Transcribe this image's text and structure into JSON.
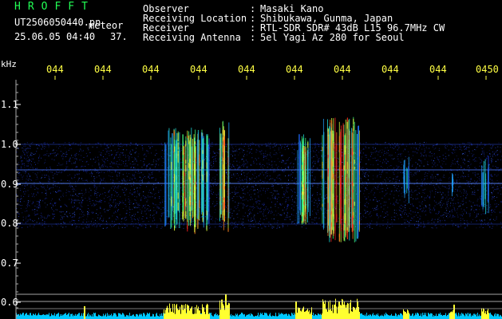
{
  "header": {
    "brand": "HROFFT",
    "filename": "UT2506050440.pn",
    "mode": "meteor",
    "datetime": "25.06.05 04:40",
    "count": "37.",
    "fields": [
      {
        "label": "Observer",
        "value": "Masaki Kano"
      },
      {
        "label": "Receiving Location",
        "value": "Shibukawa, Gunma, Japan"
      },
      {
        "label": "Receiver",
        "value": "RTL-SDR SDR# 43dB L15 96.7MHz CW"
      },
      {
        "label": "Receiving Antenna",
        "value": "5el Yagi Az 280 for Seoul"
      }
    ],
    "separator": ":"
  },
  "axes": {
    "y_unit": "kHz",
    "y_ticks": [
      "1.1",
      "1.0",
      "0.9",
      "0.8",
      "0.7",
      "0.6"
    ],
    "x_ticks": [
      "044",
      "044",
      "044",
      "044",
      "044",
      "044",
      "044",
      "044",
      "044",
      "0450"
    ]
  },
  "colors": {
    "header_text": "#ffffff",
    "brand": "#22ff55",
    "time_ticks": "#ffff44",
    "background": "#000000",
    "noise": "#1c2fb8",
    "hot": "#ff2a2a"
  }
}
